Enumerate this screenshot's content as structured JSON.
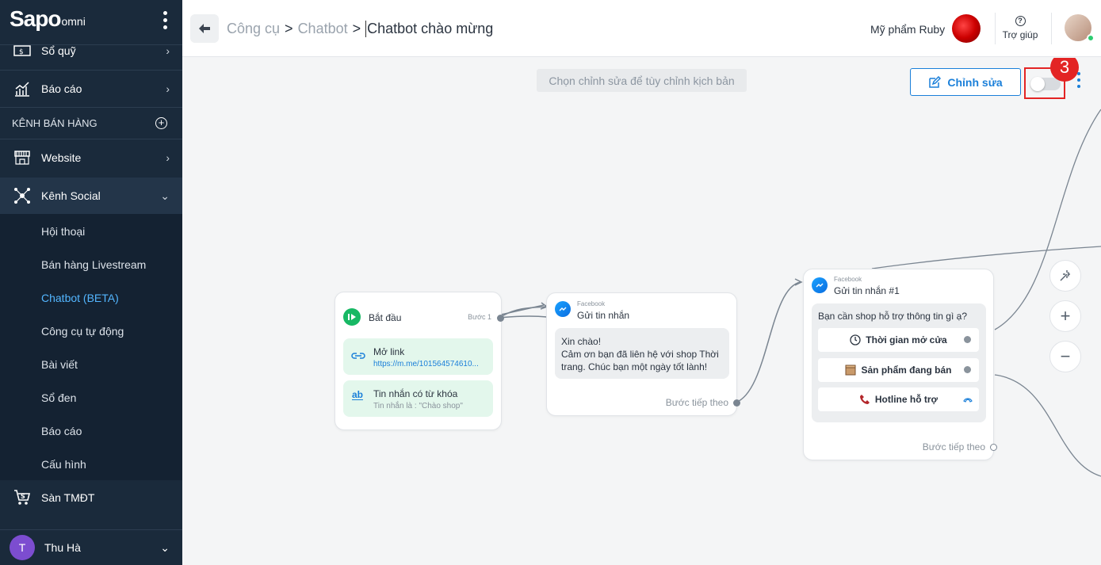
{
  "sidebar": {
    "logo_main": "Sapo",
    "logo_suffix": "omni",
    "items": [
      {
        "label": "Sổ quỹ"
      },
      {
        "label": "Báo cáo"
      }
    ],
    "section_label": "KÊNH BÁN HÀNG",
    "channels": [
      {
        "label": "Website"
      },
      {
        "label": "Kênh Social"
      }
    ],
    "submenu": [
      {
        "label": "Hội thoại"
      },
      {
        "label": "Bán hàng Livestream"
      },
      {
        "label": "Chatbot (BETA)"
      },
      {
        "label": "Công cụ tự động"
      },
      {
        "label": "Bài viết"
      },
      {
        "label": "Sổ đen"
      },
      {
        "label": "Báo cáo"
      },
      {
        "label": "Cấu hình"
      }
    ],
    "marketplace": "Sàn TMĐT",
    "user": {
      "initial": "T",
      "name": "Thu Hà"
    }
  },
  "header": {
    "breadcrumb": [
      "Công cụ",
      "Chatbot",
      "Chatbot chào mừng"
    ],
    "separator": ">",
    "shop_name": "Mỹ phẩm Ruby",
    "help_label": "Trợ giúp"
  },
  "toolbar": {
    "hint": "Chọn chỉnh sửa để tùy chỉnh kịch bản",
    "edit_label": "Chỉnh sửa",
    "step_badge": "3"
  },
  "flow": {
    "start_card": {
      "title": "Bắt đầu",
      "step_label": "Bước 1",
      "triggers": [
        {
          "title": "Mở link",
          "detail": "https://m.me/101564574610..."
        },
        {
          "title": "Tin nhắn có từ khóa",
          "detail": "Tin nhắn là : \"Chào shop\""
        }
      ]
    },
    "message_card": {
      "platform": "Facebook",
      "title": "Gửi tin nhắn",
      "message_lines": [
        "Xin chào!",
        "Cảm ơn bạn đã liên hệ với shop Thời trang. Chúc bạn một ngày tốt lành!"
      ],
      "next_label": "Bước tiếp theo"
    },
    "message_card_2": {
      "platform": "Facebook",
      "title": "Gửi tin nhắn #1",
      "question": "Bạn cần shop hỗ trợ thông tin gì ạ?",
      "options": [
        {
          "label": "Thời gian mở cửa",
          "icon": "clock-icon"
        },
        {
          "label": "Sản phẩm đang bán",
          "icon": "package-icon"
        },
        {
          "label": "Hotline hỗ trợ",
          "icon": "phone-icon"
        }
      ],
      "next_label": "Bước tiếp theo"
    }
  },
  "zoom_controls": {
    "plus": "+",
    "minus": "−"
  },
  "colors": {
    "sidebar_bg": "#1a2a3b",
    "accent": "#1a7fd9",
    "badge": "#e32424",
    "active_link": "#53b6ff"
  }
}
